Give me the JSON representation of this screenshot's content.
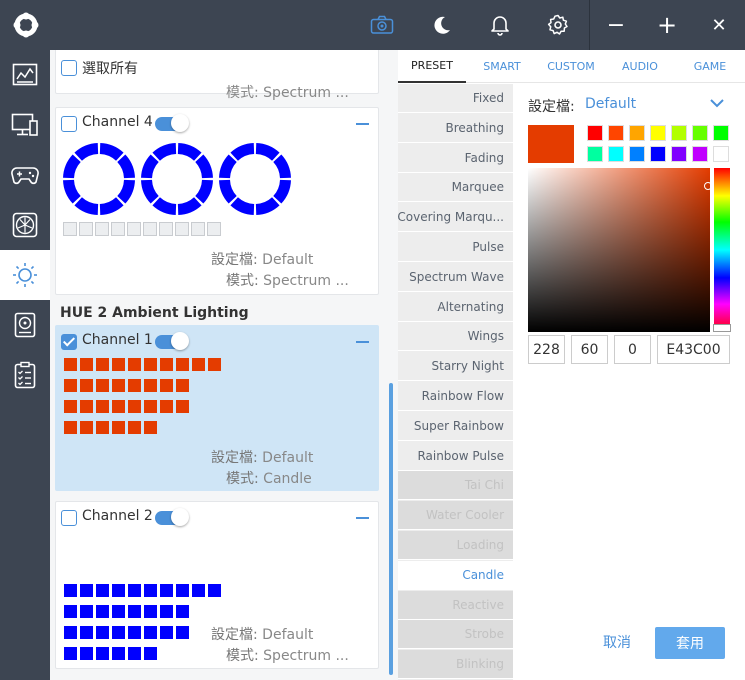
{
  "colors": {
    "accent": "#4a90d9",
    "titlebar": "#3d4552",
    "ch4_ring": "#0000ff",
    "ch1_led": "#e43c00",
    "ch2_led": "#0000ff",
    "selected_color": "#e43c00"
  },
  "titlebar": {
    "icons": [
      "logo-icon",
      "camera-icon",
      "moon-icon",
      "bell-icon",
      "gear-icon",
      "minimize-icon",
      "maximize-icon",
      "close-icon"
    ],
    "minimize": "−",
    "maximize": "+",
    "close": "✕"
  },
  "leftnav": {
    "items": [
      "dashboard-icon",
      "pc-monitor-icon",
      "gamepad-icon",
      "fan-icon",
      "lighting-icon",
      "storage-icon",
      "clipboard-icon"
    ],
    "active_index": 4
  },
  "devices": {
    "select_all": "選取所有",
    "partial_mode": "模式: Spectrum ...",
    "card1": {
      "channel": "Channel 4",
      "checked": false,
      "profile_key": "設定檔:",
      "profile": "Default",
      "mode_key": "模式:",
      "mode": "Spectrum ..."
    },
    "section_title": "HUE 2 Ambient Lighting",
    "card2": {
      "channel": "Channel 1",
      "checked": true,
      "profile_key": "設定檔:",
      "profile": "Default",
      "mode_key": "模式:",
      "mode": "Candle"
    },
    "card3": {
      "channel": "Channel 2",
      "checked": false,
      "profile_key": "設定檔:",
      "profile": "Default",
      "mode_key": "模式:",
      "mode": "Spectrum ..."
    }
  },
  "tabs": [
    "PRESET",
    "SMART",
    "CUSTOM",
    "AUDIO",
    "GAME"
  ],
  "active_tab": 0,
  "effects": [
    {
      "label": "Fixed",
      "state": "normal"
    },
    {
      "label": "Breathing",
      "state": "normal"
    },
    {
      "label": "Fading",
      "state": "normal"
    },
    {
      "label": "Marquee",
      "state": "normal"
    },
    {
      "label": "Covering Marqu...",
      "state": "normal"
    },
    {
      "label": "Pulse",
      "state": "normal"
    },
    {
      "label": "Spectrum Wave",
      "state": "normal"
    },
    {
      "label": "Alternating",
      "state": "normal"
    },
    {
      "label": "Wings",
      "state": "normal"
    },
    {
      "label": "Starry Night",
      "state": "normal"
    },
    {
      "label": "Rainbow Flow",
      "state": "normal"
    },
    {
      "label": "Super Rainbow",
      "state": "normal"
    },
    {
      "label": "Rainbow Pulse",
      "state": "normal"
    },
    {
      "label": "Tai Chi",
      "state": "disabled"
    },
    {
      "label": "Water Cooler",
      "state": "disabled"
    },
    {
      "label": "Loading",
      "state": "disabled"
    },
    {
      "label": "Candle",
      "state": "selected"
    },
    {
      "label": "Reactive",
      "state": "disabled"
    },
    {
      "label": "Strobe",
      "state": "disabled"
    },
    {
      "label": "Blinking",
      "state": "disabled"
    }
  ],
  "panel": {
    "profile_label": "設定檔:",
    "profile_value": "Default",
    "swatches": [
      "#ff0000",
      "#ff4500",
      "#ffa500",
      "#ffff00",
      "#b2ff00",
      "#66ff00",
      "#00ff00",
      "#00ffa0",
      "#00ffff",
      "#0080ff",
      "#0000ff",
      "#8000ff",
      "#c000ff",
      "#ffffff"
    ],
    "r": "228",
    "g": "60",
    "b": "0",
    "hex": "E43C00",
    "cancel": "取消",
    "apply": "套用"
  }
}
